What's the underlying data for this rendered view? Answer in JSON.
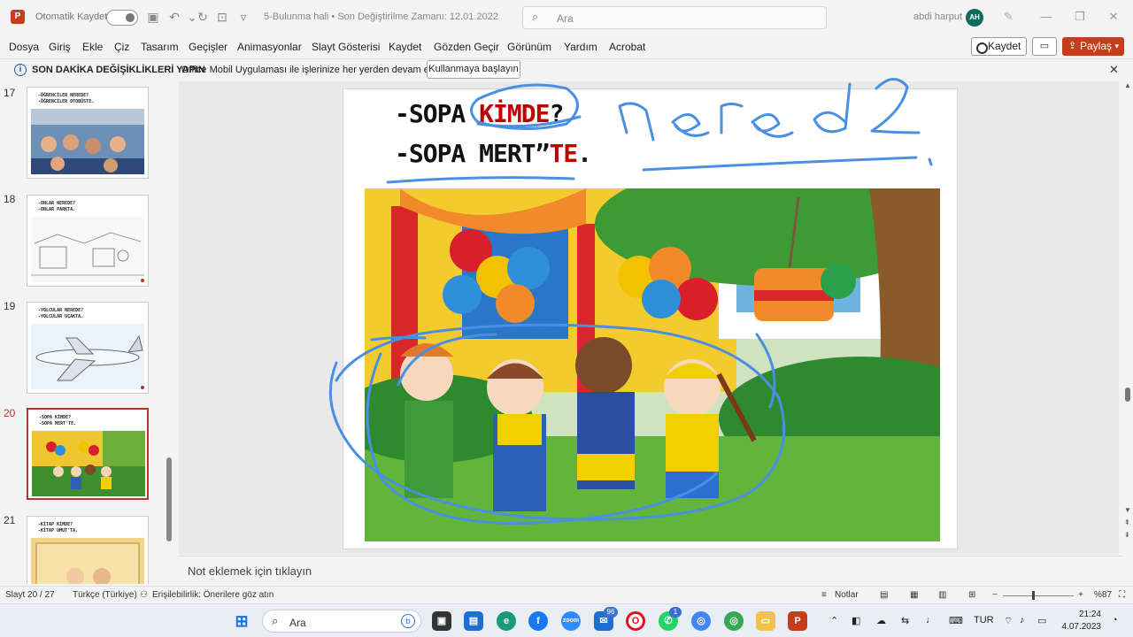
{
  "titlebar": {
    "autosave_label": "Otomatik Kaydet",
    "document_title": "5-Bulunma hali • Son Değiştirilme Zamanı: 12.01.2022",
    "search_placeholder": "Ara",
    "user_name": "abdi harput",
    "user_initials": "AH",
    "app_logo": "P"
  },
  "menu": {
    "items": [
      "Dosya",
      "Giriş",
      "Ekle",
      "Çiz",
      "Tasarım",
      "Geçişler",
      "Animasyonlar",
      "Slayt Gösterisi",
      "Kaydet",
      "Gözden Geçir",
      "Görünüm",
      "Yardım",
      "Acrobat"
    ],
    "record_button": "Kaydet",
    "share_button": "Paylaş"
  },
  "infobar": {
    "headline": "SON DAKİKA DEĞİŞİKLİKLERİ YAPIN",
    "message": "Office Mobil Uygulaması ile işlerinize her yerden devam edin",
    "action_button": "Kullanmaya başlayın"
  },
  "thumbnails": [
    {
      "number": "17",
      "line1": "-ÖĞRENCİLER NEREDE?",
      "line2": "-ÖĞRENCİLER OTOBÜSTE."
    },
    {
      "number": "18",
      "line1": "-ONLAR NEREDE?",
      "line2": "-ONLAR PARKTA."
    },
    {
      "number": "19",
      "line1": "-YOLCULAR NEREDE?",
      "line2": "-YOLCULAR UÇAKTA."
    },
    {
      "number": "20",
      "line1": "-SOPA KİMDE?",
      "line2": "-SOPA MERT'TE."
    },
    {
      "number": "21",
      "line1": "-KİTAP KİMDE?",
      "line2": "-KİTAP UMUT'TA."
    }
  ],
  "slide": {
    "line1_prefix": "-SOPA ",
    "line1_red": "KİMDE",
    "line1_suffix": "?",
    "line2_prefix": "-SOPA MERT”",
    "line2_red": "TE",
    "line2_suffix": "."
  },
  "notes_placeholder": "Not eklemek için tıklayın",
  "statusbar": {
    "slide_counter": "Slayt 20 / 27",
    "language": "Türkçe (Türkiye)",
    "accessibility": "Erişilebilirlik: Önerilere göz atın",
    "notes_button": "Notlar",
    "zoom": "%87"
  },
  "taskbar": {
    "search_text": "Ara",
    "mail_badge": "96",
    "whatsapp_badge": "1",
    "language": "TUR",
    "time": "21:24",
    "date": "4.07.2023"
  },
  "colors": {
    "brand": "#c43e1c",
    "selection": "#b5372b",
    "ink": "#4a90e2",
    "slide_red": "#c00000"
  }
}
